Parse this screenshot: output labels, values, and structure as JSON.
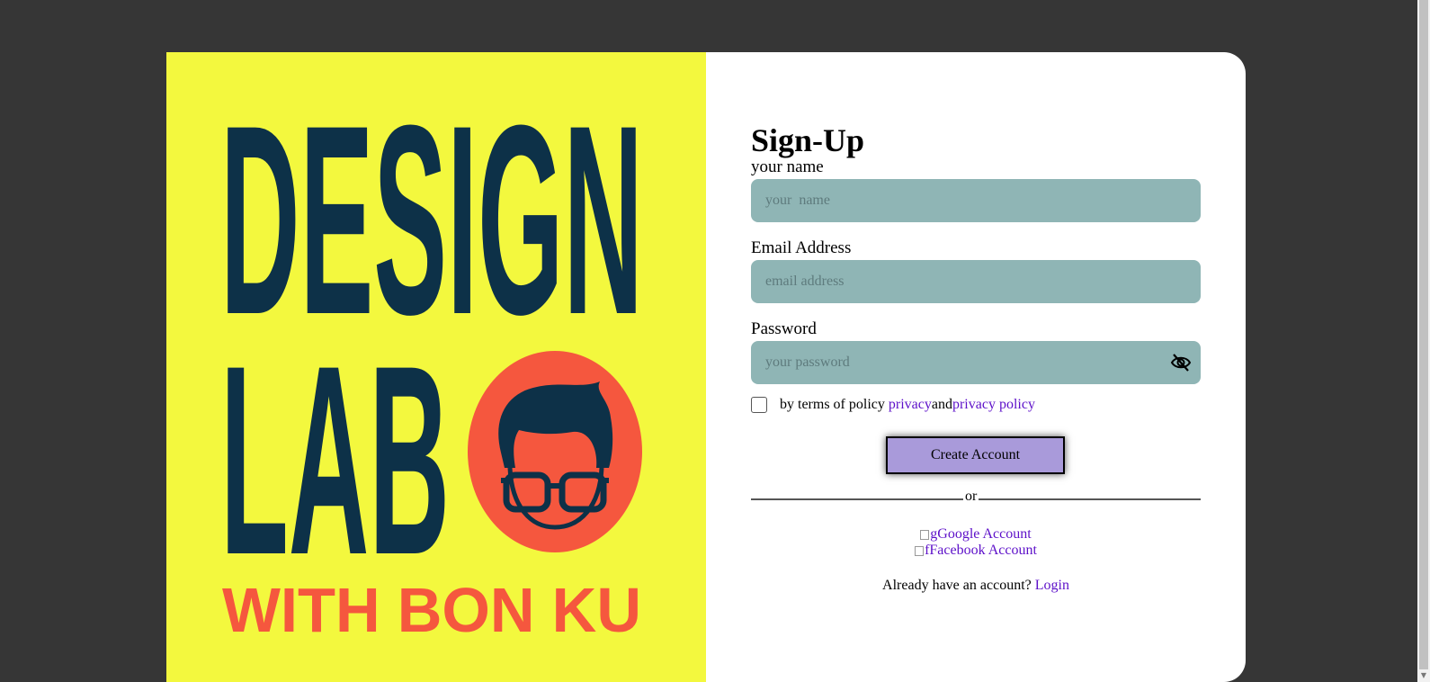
{
  "poster": {
    "line1": "DESIGN",
    "line2": "LAB",
    "line3": "WITH BON KU",
    "colors": {
      "background": "#f3f83e",
      "navy": "#0d3148",
      "coral": "#f5573e"
    }
  },
  "form": {
    "title": "Sign-Up",
    "name": {
      "label": "your name",
      "placeholder": "your  name",
      "value": ""
    },
    "email": {
      "label": "Email Address",
      "placeholder": "email address",
      "value": ""
    },
    "password": {
      "label": "Password",
      "placeholder": "your password",
      "value": "",
      "toggle_icon": "eye-off-icon"
    },
    "terms": {
      "text": "by terms of policy ",
      "link1": "privacy",
      "and": "and",
      "link2": "privacy policy"
    },
    "create_button": "Create Account",
    "or": "or",
    "google": {
      "img_alt": "g",
      "label": "Google Account"
    },
    "facebook": {
      "img_alt": "f",
      "label": "Facebook Account"
    },
    "already": {
      "text": "Already have an account? ",
      "link": "Login"
    },
    "colors": {
      "field": "#8fb5b5",
      "button": "#a99ada",
      "link": "#5d10c9"
    }
  }
}
